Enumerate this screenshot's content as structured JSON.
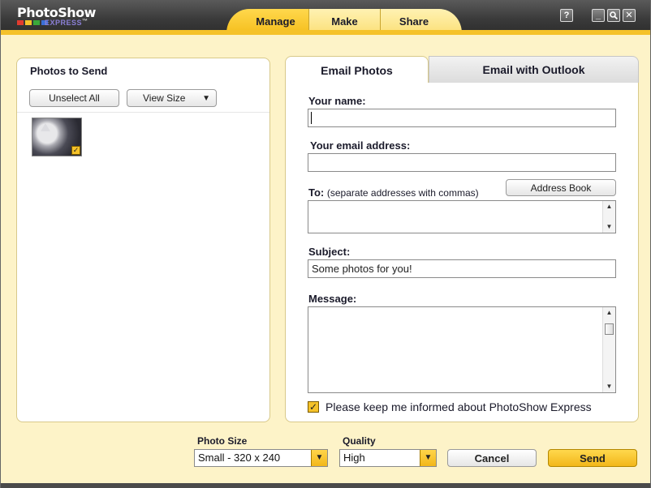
{
  "app": {
    "logo_main": "PhotoShow",
    "logo_sub": "EXPRESS",
    "logo_tm": "™",
    "logo_colors": [
      "#e23b2e",
      "#f5c22a",
      "#3aa83a",
      "#3b6fd6"
    ]
  },
  "nav": {
    "tabs": [
      {
        "label": "Manage",
        "active": true
      },
      {
        "label": "Make",
        "active": false
      },
      {
        "label": "Share",
        "active": false
      }
    ]
  },
  "window_controls": {
    "help": "?",
    "minimize": "_",
    "search": "🔍",
    "close": "✕"
  },
  "left_panel": {
    "title": "Photos to Send",
    "unselect_all": "Unselect All",
    "view_size": "View Size",
    "view_size_arrow": "▼",
    "photo_checked_mark": "✓"
  },
  "tabs": {
    "email_photos": "Email Photos",
    "email_outlook": "Email with Outlook"
  },
  "form": {
    "name_label": "Your name:",
    "name_value": "",
    "email_label": "Your email address:",
    "email_value": "",
    "to_label": "To:",
    "to_hint": "(separate addresses with commas)",
    "address_book": "Address Book",
    "to_value": "",
    "subject_label": "Subject:",
    "subject_value": "Some photos for you!",
    "message_label": "Message:",
    "message_value": "",
    "scroll_up": "▲",
    "scroll_down": "▼",
    "keep_informed": "Please keep me informed about PhotoShow Express",
    "keep_informed_checked": "✓"
  },
  "bottom": {
    "photo_size_label": "Photo Size",
    "photo_size_value": "Small - 320 x 240",
    "quality_label": "Quality",
    "quality_value": "High",
    "dropdown_arrow": "▼",
    "cancel": "Cancel",
    "send": "Send"
  },
  "colors": {
    "accent_yellow": "#f5c22a",
    "panel_bg": "#fdf3c8",
    "header_dark": "#3a3a3a"
  }
}
